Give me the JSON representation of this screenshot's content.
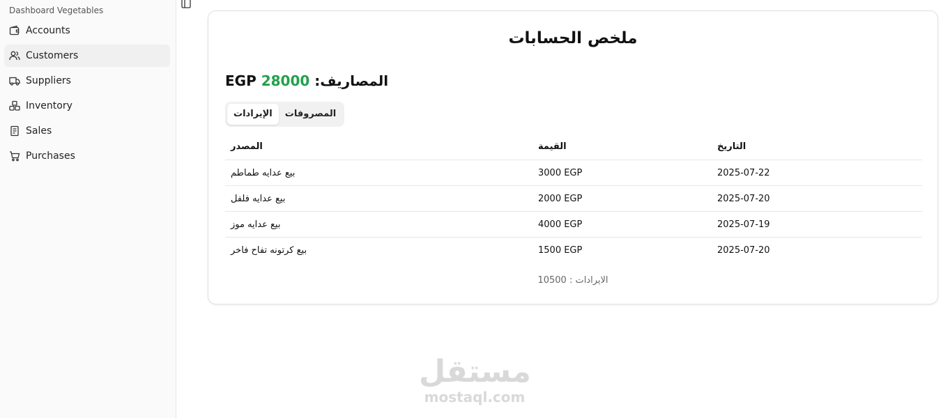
{
  "sidebar": {
    "title": "Dashboard Vegetables",
    "items": [
      {
        "label": "Accounts",
        "icon": "wallet-icon"
      },
      {
        "label": "Customers",
        "icon": "users-icon"
      },
      {
        "label": "Suppliers",
        "icon": "truck-icon"
      },
      {
        "label": "Inventory",
        "icon": "boxes-icon"
      },
      {
        "label": "Sales",
        "icon": "receipt-icon"
      },
      {
        "label": "Purchases",
        "icon": "cart-icon"
      }
    ],
    "active_item": "Customers"
  },
  "card": {
    "title": "ملخص الحسابات",
    "summary_label": "المصاريف:",
    "summary_amount": "28000",
    "summary_currency": "EGP",
    "accent_color": "#22a04b",
    "tabs": [
      {
        "label": "المصروفات",
        "active": false
      },
      {
        "label": "الإيرادات",
        "active": true
      }
    ],
    "table": {
      "headers": {
        "source": "المصدر",
        "value": "القيمة",
        "date": "التاريخ"
      },
      "rows": [
        {
          "source": "بيع عدايه طماطم",
          "value": "3000 EGP",
          "date": "2025-07-22"
        },
        {
          "source": "بيع عدايه فلفل",
          "value": "2000 EGP",
          "date": "2025-07-20"
        },
        {
          "source": "بيع عدايه موز",
          "value": "4000 EGP",
          "date": "2025-07-19"
        },
        {
          "source": "بيع كرتونه تفاح فاخر",
          "value": "1500 EGP",
          "date": "2025-07-20"
        }
      ]
    },
    "footer": "الايرادات : 10500"
  },
  "watermark": {
    "arabic": "مستقل",
    "latin": "mostaql.com"
  }
}
